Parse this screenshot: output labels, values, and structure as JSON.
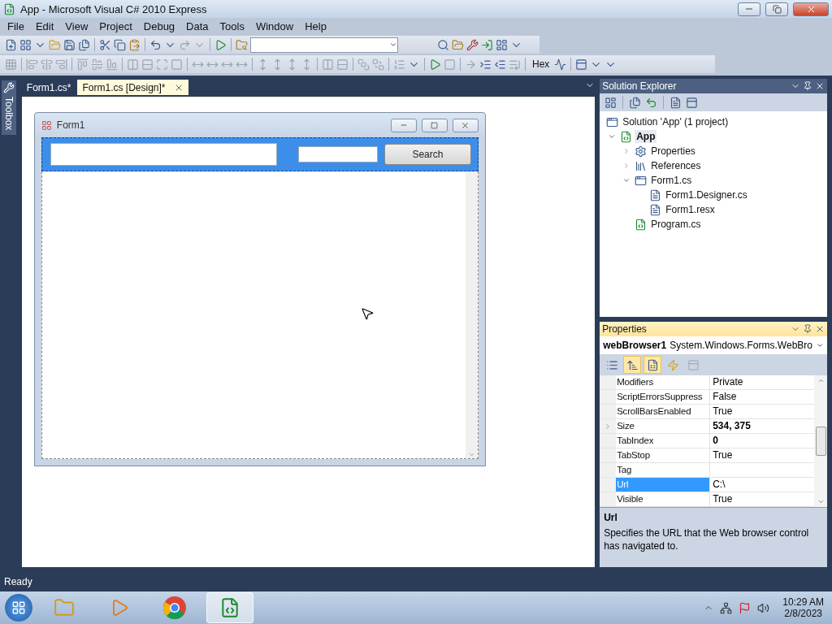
{
  "window": {
    "title": "App - Microsoft Visual C# 2010 Express"
  },
  "menu": [
    "File",
    "Edit",
    "View",
    "Project",
    "Debug",
    "Data",
    "Tools",
    "Window",
    "Help"
  ],
  "toolbar": {
    "hex_label": "Hex"
  },
  "document_tabs": [
    {
      "label": "Form1.cs*",
      "selected": false
    },
    {
      "label": "Form1.cs [Design]*",
      "selected": true
    }
  ],
  "toolbox": {
    "label": "Toolbox"
  },
  "designer": {
    "form_title": "Form1",
    "search_button": "Search"
  },
  "solution_explorer": {
    "title": "Solution Explorer",
    "tree": [
      {
        "label": "Solution 'App' (1 project)",
        "kind": "solution",
        "bold": false,
        "children": [
          {
            "label": "App",
            "kind": "project",
            "bold": true,
            "expanded": true,
            "children": [
              {
                "label": "Properties",
                "kind": "properties",
                "bold": false,
                "expanded": false
              },
              {
                "label": "References",
                "kind": "references",
                "bold": false,
                "expanded": false
              },
              {
                "label": "Form1.cs",
                "kind": "form",
                "bold": false,
                "expanded": true,
                "children": [
                  {
                    "label": "Form1.Designer.cs",
                    "kind": "file",
                    "bold": false
                  },
                  {
                    "label": "Form1.resx",
                    "kind": "file",
                    "bold": false
                  }
                ]
              },
              {
                "label": "Program.cs",
                "kind": "code",
                "bold": false
              }
            ]
          }
        ]
      }
    ]
  },
  "properties": {
    "title": "Properties",
    "object_name": "webBrowser1",
    "object_type": "System.Windows.Forms.WebBro",
    "view_buttons": [
      {
        "selected": false,
        "disabled": false
      },
      {
        "selected": true,
        "disabled": false
      },
      {
        "selected": true,
        "disabled": false
      },
      {
        "selected": false,
        "disabled": false
      },
      {
        "selected": false,
        "disabled": true
      }
    ],
    "rows": [
      {
        "name": "Modifiers",
        "value": "Private",
        "bold": false,
        "selected": false,
        "expandable": false
      },
      {
        "name": "ScriptErrorsSuppress",
        "value": "False",
        "bold": false,
        "selected": false,
        "expandable": false
      },
      {
        "name": "ScrollBarsEnabled",
        "value": "True",
        "bold": false,
        "selected": false,
        "expandable": false
      },
      {
        "name": "Size",
        "value": "534, 375",
        "bold": true,
        "selected": false,
        "expandable": true
      },
      {
        "name": "TabIndex",
        "value": "0",
        "bold": true,
        "selected": false,
        "expandable": false
      },
      {
        "name": "TabStop",
        "value": "True",
        "bold": false,
        "selected": false,
        "expandable": false
      },
      {
        "name": "Tag",
        "selected": false,
        "expandable": false
      },
      {
        "name": "Url",
        "value": "C:\\",
        "bold": false,
        "selected": true,
        "expandable": false
      },
      {
        "name": "Visible",
        "value": "True",
        "bold": false,
        "selected": false,
        "expandable": false
      }
    ],
    "description_title": "Url",
    "description": "Specifies the URL that the Web browser control has navigated to."
  },
  "status_bar": {
    "text": "Ready"
  },
  "taskbar": {
    "apps": [
      {
        "kind": "explorer",
        "selected": false
      },
      {
        "kind": "media",
        "selected": false
      },
      {
        "kind": "browser",
        "selected": false
      },
      {
        "kind": "csharp",
        "selected": true
      }
    ],
    "time": "10:29 AM",
    "date": "2/8/2023"
  }
}
